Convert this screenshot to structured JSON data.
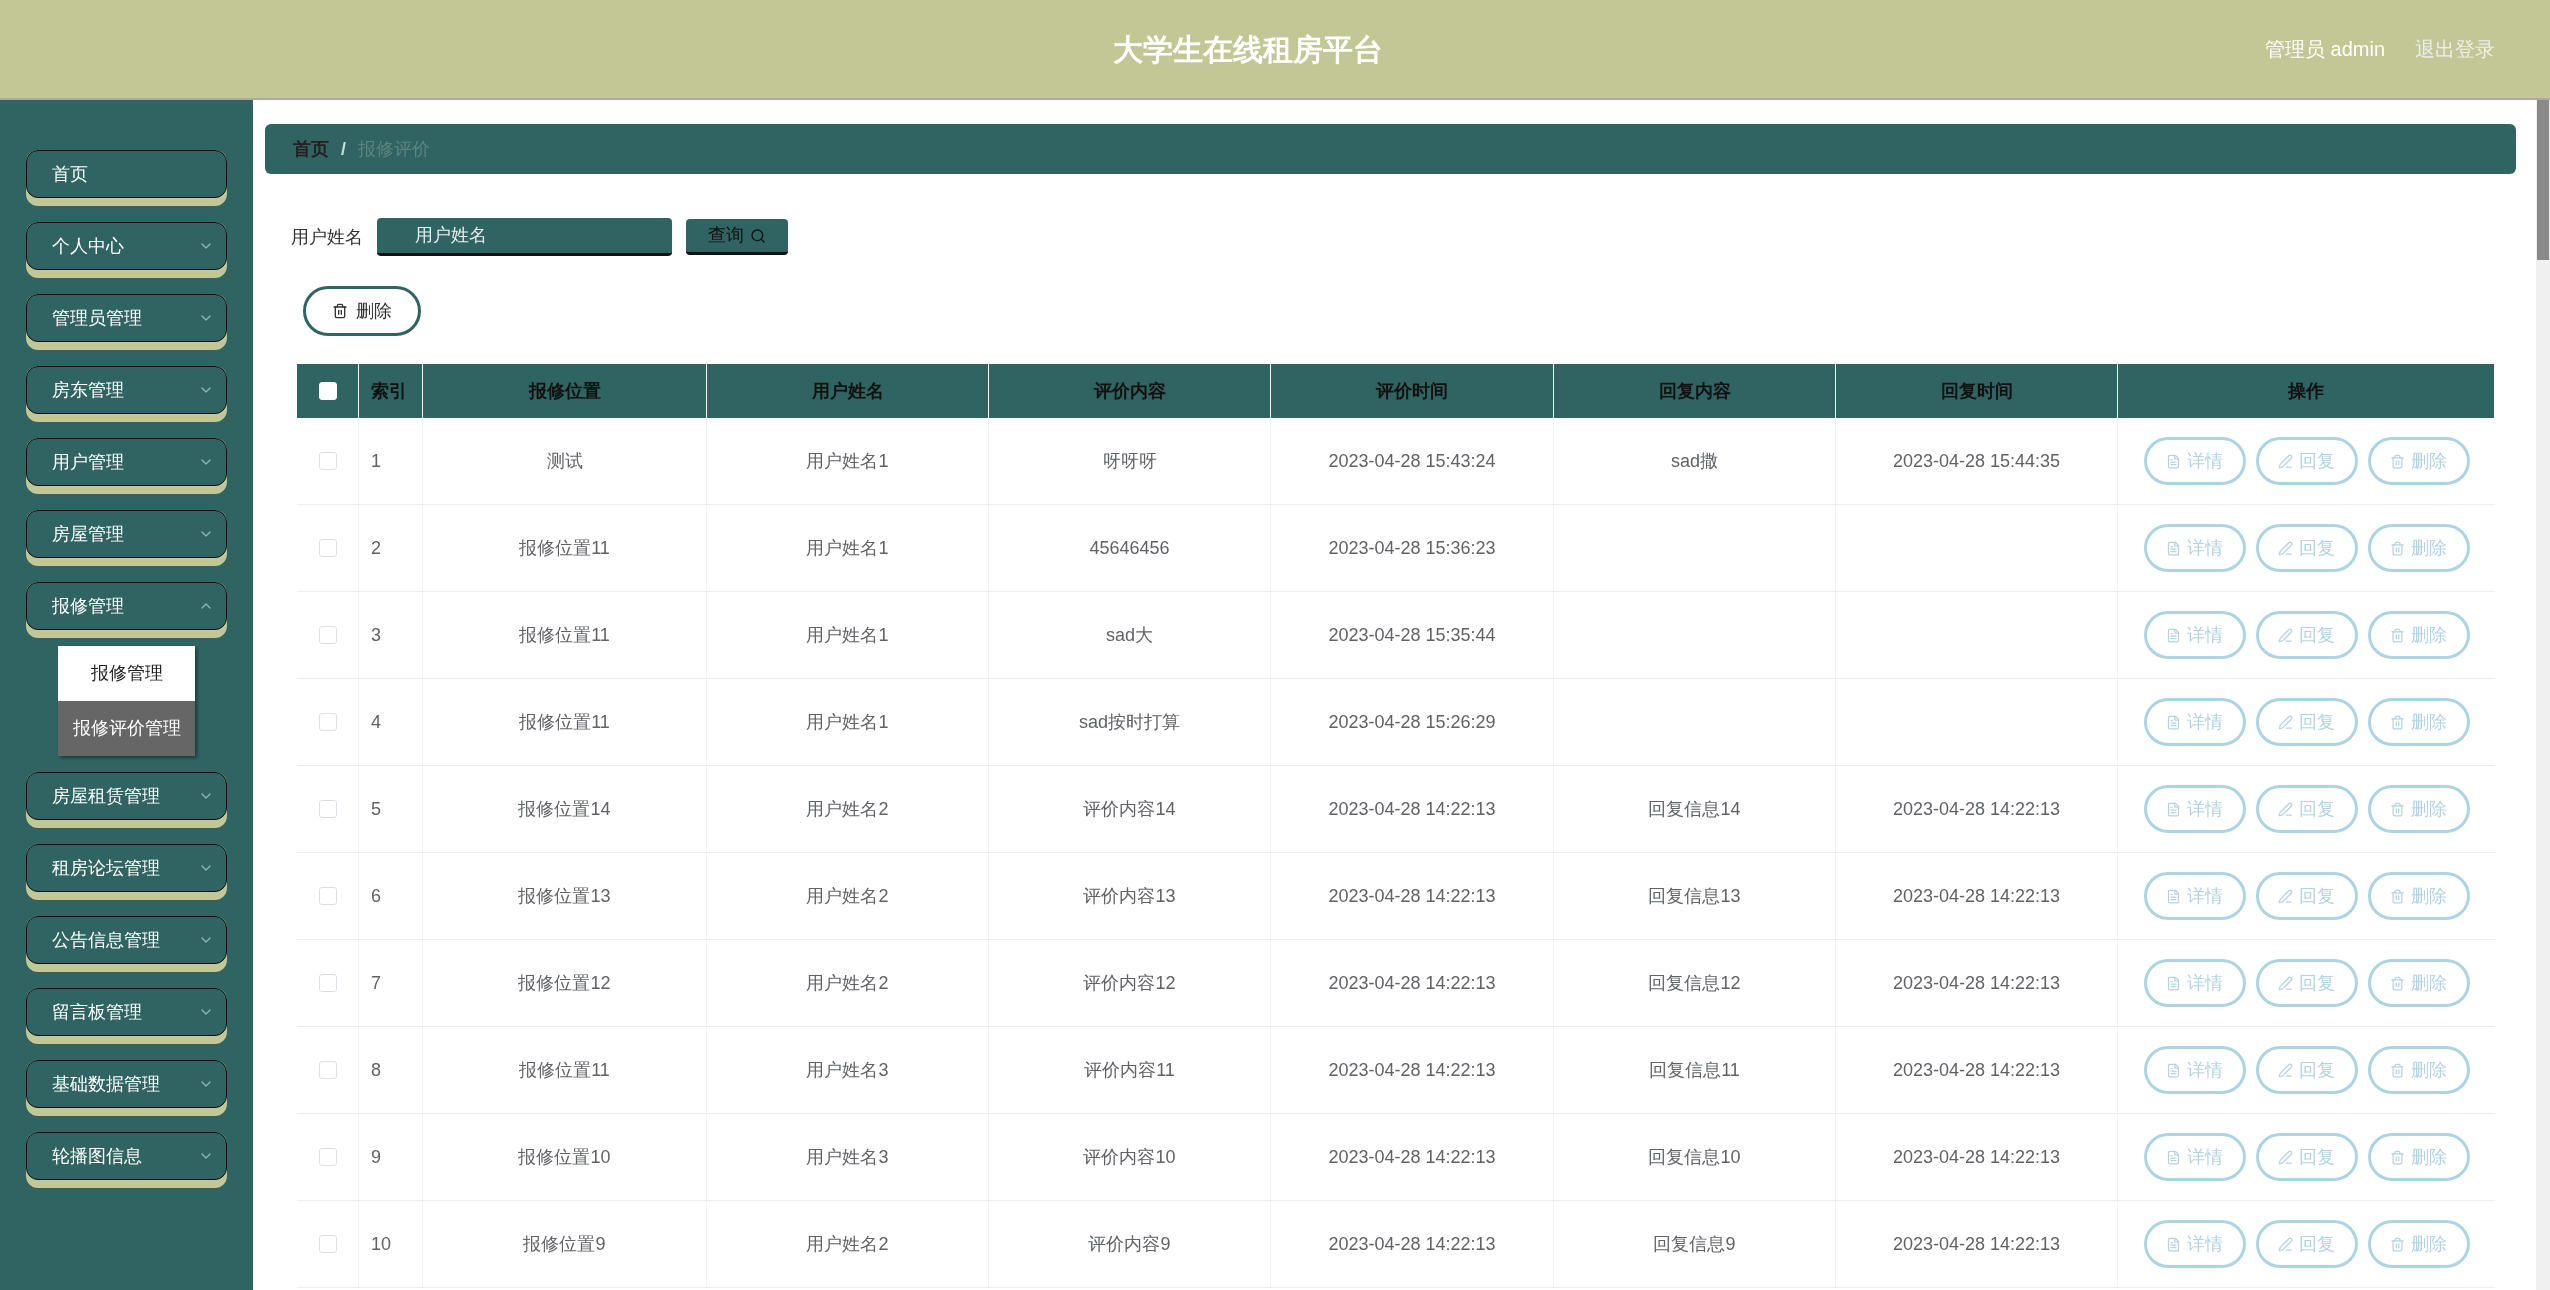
{
  "header": {
    "title": "大学生在线租房平台",
    "user": "管理员 admin",
    "logout": "退出登录"
  },
  "sidebar": {
    "items": [
      {
        "label": "首页",
        "kind": "link"
      },
      {
        "label": "个人中心",
        "kind": "menu",
        "expanded": false
      },
      {
        "label": "管理员管理",
        "kind": "menu",
        "expanded": false
      },
      {
        "label": "房东管理",
        "kind": "menu",
        "expanded": false
      },
      {
        "label": "用户管理",
        "kind": "menu",
        "expanded": false
      },
      {
        "label": "房屋管理",
        "kind": "menu",
        "expanded": false
      },
      {
        "label": "报修管理",
        "kind": "menu",
        "expanded": true,
        "children": [
          {
            "label": "报修管理",
            "selected": false
          },
          {
            "label": "报修评价管理",
            "selected": true
          }
        ]
      },
      {
        "label": "房屋租赁管理",
        "kind": "menu",
        "expanded": false
      },
      {
        "label": "租房论坛管理",
        "kind": "menu",
        "expanded": false
      },
      {
        "label": "公告信息管理",
        "kind": "menu",
        "expanded": false
      },
      {
        "label": "留言板管理",
        "kind": "menu",
        "expanded": false
      },
      {
        "label": "基础数据管理",
        "kind": "menu",
        "expanded": false
      },
      {
        "label": "轮播图信息",
        "kind": "menu",
        "expanded": false
      }
    ]
  },
  "breadcrumb": {
    "items": [
      "首页",
      "报修评价"
    ],
    "separator": "/"
  },
  "search": {
    "label": "用户姓名",
    "placeholder": "用户姓名",
    "button": "查询"
  },
  "delete_button": "删除",
  "table": {
    "select_all": {
      "checked": false
    },
    "columns": [
      "索引",
      "报修位置",
      "用户姓名",
      "评价内容",
      "评价时间",
      "回复内容",
      "回复时间",
      "操作"
    ],
    "rows": [
      {
        "checked": false,
        "cells": [
          "1",
          "测试",
          "用户姓名1",
          "呀呀呀",
          "2023-04-28 15:43:24",
          "sad撒",
          "2023-04-28 15:44:35"
        ],
        "actions": [
          "详情",
          "回复",
          "删除"
        ]
      },
      {
        "checked": false,
        "cells": [
          "2",
          "报修位置11",
          "用户姓名1",
          "45646456",
          "2023-04-28 15:36:23",
          "",
          ""
        ],
        "actions": [
          "详情",
          "回复",
          "删除"
        ]
      },
      {
        "checked": false,
        "cells": [
          "3",
          "报修位置11",
          "用户姓名1",
          "sad大",
          "2023-04-28 15:35:44",
          "",
          ""
        ],
        "actions": [
          "详情",
          "回复",
          "删除"
        ]
      },
      {
        "checked": false,
        "cells": [
          "4",
          "报修位置11",
          "用户姓名1",
          "sad按时打算",
          "2023-04-28 15:26:29",
          "",
          ""
        ],
        "actions": [
          "详情",
          "回复",
          "删除"
        ]
      },
      {
        "checked": false,
        "cells": [
          "5",
          "报修位置14",
          "用户姓名2",
          "评价内容14",
          "2023-04-28 14:22:13",
          "回复信息14",
          "2023-04-28 14:22:13"
        ],
        "actions": [
          "详情",
          "回复",
          "删除"
        ]
      },
      {
        "checked": false,
        "cells": [
          "6",
          "报修位置13",
          "用户姓名2",
          "评价内容13",
          "2023-04-28 14:22:13",
          "回复信息13",
          "2023-04-28 14:22:13"
        ],
        "actions": [
          "详情",
          "回复",
          "删除"
        ]
      },
      {
        "checked": false,
        "cells": [
          "7",
          "报修位置12",
          "用户姓名2",
          "评价内容12",
          "2023-04-28 14:22:13",
          "回复信息12",
          "2023-04-28 14:22:13"
        ],
        "actions": [
          "详情",
          "回复",
          "删除"
        ]
      },
      {
        "checked": false,
        "cells": [
          "8",
          "报修位置11",
          "用户姓名3",
          "评价内容11",
          "2023-04-28 14:22:13",
          "回复信息11",
          "2023-04-28 14:22:13"
        ],
        "actions": [
          "详情",
          "回复",
          "删除"
        ]
      },
      {
        "checked": false,
        "cells": [
          "9",
          "报修位置10",
          "用户姓名3",
          "评价内容10",
          "2023-04-28 14:22:13",
          "回复信息10",
          "2023-04-28 14:22:13"
        ],
        "actions": [
          "详情",
          "回复",
          "删除"
        ]
      },
      {
        "checked": false,
        "cells": [
          "10",
          "报修位置9",
          "用户姓名2",
          "评价内容9",
          "2023-04-28 14:22:13",
          "回复信息9",
          "2023-04-28 14:22:13"
        ],
        "actions": [
          "详情",
          "回复",
          "删除"
        ]
      }
    ]
  }
}
